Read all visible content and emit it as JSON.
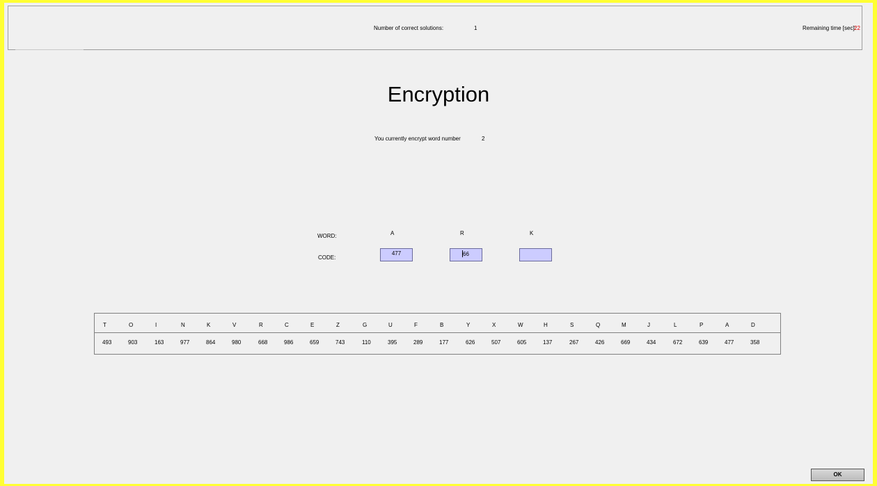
{
  "header": {
    "correct_label": "Number of correct solutions:",
    "correct_value": "1",
    "time_label": "Remaining time [sec]:",
    "time_value": "22"
  },
  "main": {
    "title": "Encryption",
    "current_label": "You currently encrypt word number",
    "current_value": "2",
    "word_label": "WORD:",
    "code_label": "CODE:",
    "letters": [
      "A",
      "R",
      "K"
    ],
    "codes": [
      "477",
      "66",
      ""
    ]
  },
  "table": {
    "letters": [
      "T",
      "O",
      "I",
      "N",
      "K",
      "V",
      "R",
      "C",
      "E",
      "Z",
      "G",
      "U",
      "F",
      "B",
      "Y",
      "X",
      "W",
      "H",
      "S",
      "Q",
      "M",
      "J",
      "L",
      "P",
      "A",
      "D"
    ],
    "codes": [
      "493",
      "903",
      "163",
      "977",
      "864",
      "980",
      "668",
      "986",
      "659",
      "743",
      "110",
      "395",
      "289",
      "177",
      "626",
      "507",
      "605",
      "137",
      "267",
      "426",
      "669",
      "434",
      "672",
      "639",
      "477",
      "358"
    ]
  },
  "footer": {
    "ok_label": "OK"
  },
  "colors": {
    "frame": "#ffff33",
    "input_bg": "#ccccff",
    "timer": "#e00000"
  }
}
